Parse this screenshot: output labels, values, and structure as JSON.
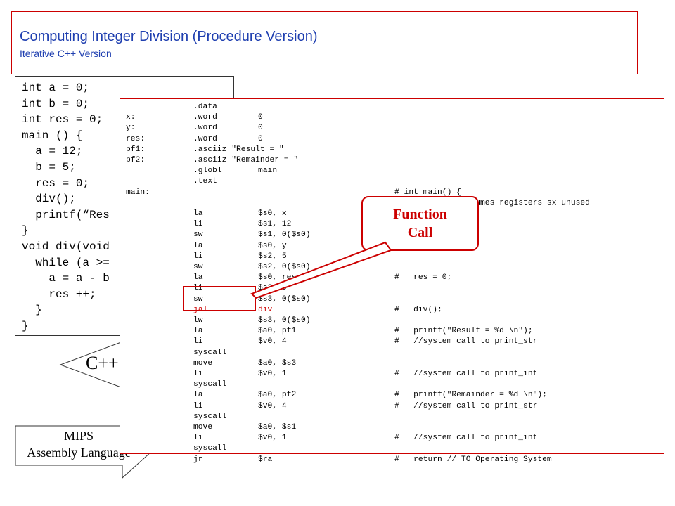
{
  "header": {
    "title": "Computing Integer Division (Procedure Version)",
    "subtitle": "Iterative C++ Version"
  },
  "cpp_code": [
    "int a = 0;",
    "int b = 0;",
    "int res = 0;",
    "main () {",
    "  a = 12;",
    "  b = 5;",
    "  res = 0;",
    "  div();",
    "  printf(“Res",
    "}",
    "void div(void",
    "  while (a >=",
    "    a = a - b",
    "    res ++;",
    "  }",
    "}"
  ],
  "labels": {
    "cpp_arrow": "C++",
    "mips_line1": "MIPS",
    "mips_line2": "Assembly Language"
  },
  "asm_lines": [
    {
      "label": "",
      "op": ".data",
      "args": "",
      "comment": ""
    },
    {
      "label": "x:",
      "op": ".word",
      "args": "0",
      "comment": ""
    },
    {
      "label": "y:",
      "op": ".word",
      "args": "0",
      "comment": ""
    },
    {
      "label": "res:",
      "op": ".word",
      "args": "0",
      "comment": ""
    },
    {
      "label": "pf1:",
      "op": ".asciiz \"Result = \"",
      "args": "",
      "comment": ""
    },
    {
      "label": "pf2:",
      "op": ".asciiz \"Remainder = \"",
      "args": "",
      "comment": ""
    },
    {
      "label": "",
      "op": ".globl",
      "args": "main",
      "comment": ""
    },
    {
      "label": "",
      "op": ".text",
      "args": "",
      "comment": ""
    },
    {
      "label": "main:",
      "op": "",
      "args": "",
      "comment": "# int main() {"
    },
    {
      "label": "",
      "op": "",
      "args": "",
      "comment": "#     // code assumes registers sx unused"
    },
    {
      "label": "",
      "op": "la",
      "args": "$s0, x",
      "comment": ""
    },
    {
      "label": "",
      "op": "li",
      "args": "$s1, 12",
      "comment": ""
    },
    {
      "label": "",
      "op": "sw",
      "args": "$s1, 0($s0)",
      "comment": ""
    },
    {
      "label": "",
      "op": "la",
      "args": "$s0, y",
      "comment": ""
    },
    {
      "label": "",
      "op": "li",
      "args": "$s2, 5",
      "comment": ""
    },
    {
      "label": "",
      "op": "sw",
      "args": "$s2, 0($s0)",
      "comment": ""
    },
    {
      "label": "",
      "op": "la",
      "args": "$s0, res",
      "comment": "#   res = 0;"
    },
    {
      "label": "",
      "op": "li",
      "args": "$s3, 0",
      "comment": ""
    },
    {
      "label": "",
      "op": "sw",
      "args": "$s3, 0($s0)",
      "comment": ""
    },
    {
      "label": "",
      "op": "jal",
      "args": "div",
      "comment": "#   div();",
      "highlight": true
    },
    {
      "label": "",
      "op": "lw",
      "args": "$s3, 0($s0)",
      "comment": ""
    },
    {
      "label": "",
      "op": "la",
      "args": "$a0, pf1",
      "comment": "#   printf(\"Result = %d \\n\");"
    },
    {
      "label": "",
      "op": "li",
      "args": "$v0, 4",
      "comment": "#   //system call to print_str"
    },
    {
      "label": "",
      "op": "syscall",
      "args": "",
      "comment": ""
    },
    {
      "label": "",
      "op": "move",
      "args": "$a0, $s3",
      "comment": ""
    },
    {
      "label": "",
      "op": "li",
      "args": "$v0, 1",
      "comment": "#   //system call to print_int"
    },
    {
      "label": "",
      "op": "syscall",
      "args": "",
      "comment": ""
    },
    {
      "label": "",
      "op": "la",
      "args": "$a0, pf2",
      "comment": "#   printf(\"Remainder = %d \\n\");"
    },
    {
      "label": "",
      "op": "li",
      "args": "$v0, 4",
      "comment": "#   //system call to print_str"
    },
    {
      "label": "",
      "op": "syscall",
      "args": "",
      "comment": ""
    },
    {
      "label": "",
      "op": "move",
      "args": "$a0, $s1",
      "comment": ""
    },
    {
      "label": "",
      "op": "li",
      "args": "$v0, 1",
      "comment": "#   //system call to print_int"
    },
    {
      "label": "",
      "op": "syscall",
      "args": "",
      "comment": ""
    },
    {
      "label": "",
      "op": "jr",
      "args": "$ra",
      "comment": "#   return // TO Operating System"
    }
  ],
  "callout": {
    "line1": "Function",
    "line2": "Call"
  },
  "colors": {
    "title": "#1f3fb0",
    "accent": "#cc0000"
  }
}
